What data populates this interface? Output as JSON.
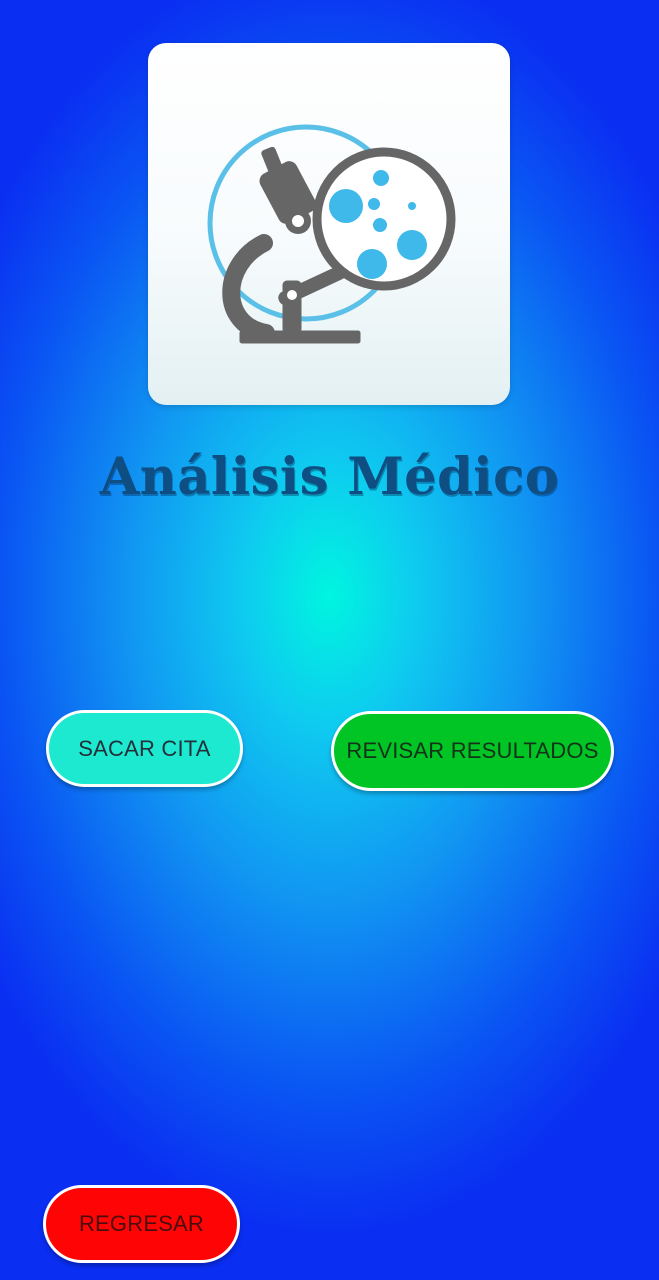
{
  "app": {
    "title": "Análisis Médico"
  },
  "logo": {
    "icon": "microscope-with-petri-dish",
    "colors": {
      "microscope": "#666666",
      "ring": "#5bc0e8",
      "dots": "#3fb8ea"
    }
  },
  "buttons": {
    "sacar_cita": "SACAR CITA",
    "revisar_resultados": "REVISAR RESULTADOS",
    "regresar": "REGRESAR"
  },
  "colors": {
    "background_center": "#00f5e0",
    "background_edge": "#0a2ef2",
    "title": "#0e4e82",
    "btn_cita": "#1de9d1",
    "btn_resultados": "#00c524",
    "btn_regresar": "#ff0404"
  }
}
